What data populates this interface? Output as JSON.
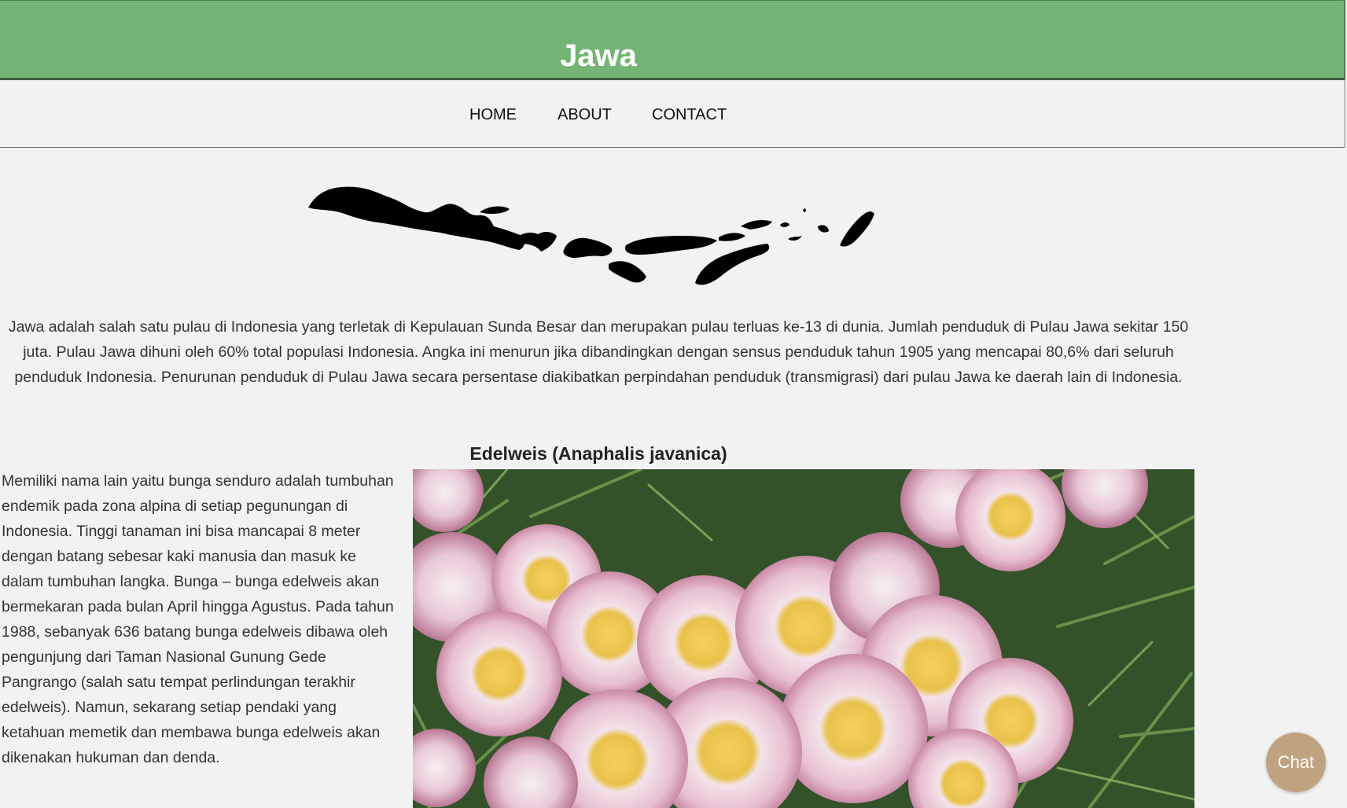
{
  "header": {
    "title": "Jawa",
    "background": "#74b474"
  },
  "nav": {
    "items": [
      {
        "label": "HOME"
      },
      {
        "label": "ABOUT"
      },
      {
        "label": "CONTACT"
      }
    ]
  },
  "intro": {
    "text": "Jawa adalah salah satu pulau di Indonesia yang terletak di Kepulauan Sunda Besar dan merupakan pulau terluas ke-13 di dunia. Jumlah penduduk di Pulau Jawa sekitar 150 juta. Pulau Jawa dihuni oleh 60% total populasi Indonesia. Angka ini menurun jika dibandingkan dengan sensus penduduk tahun 1905 yang mencapai 80,6% dari seluruh penduduk Indonesia. Penurunan penduduk di Pulau Jawa secara persentase diakibatkan perpindahan penduduk (transmigrasi) dari pulau Jawa ke daerah lain di Indonesia."
  },
  "flora": {
    "title": "Edelweis (Anaphalis javanica)",
    "description": "Memiliki nama lain yaitu bunga senduro adalah tumbuhan endemik pada zona alpina di setiap pegunungan di Indonesia. Tinggi tanaman ini bisa mancapai 8 meter dengan batang sebesar kaki manusia dan masuk ke dalam tumbuhan langka. Bunga – bunga edelweis akan bermekaran pada bulan April hingga Agustus. Pada tahun 1988, sebanyak 636 batang bunga edelweis dibawa oleh pengunjung dari Taman Nasional Gunung Gede Pangrango (salah satu tempat perlindungan terakhir edelweis). Namun, sekarang setiap pendaki yang ketahuan memetik dan membawa bunga edelweis akan dikenakan hukuman dan denda."
  },
  "chat": {
    "label": "Chat",
    "color": "#bfa27f"
  }
}
